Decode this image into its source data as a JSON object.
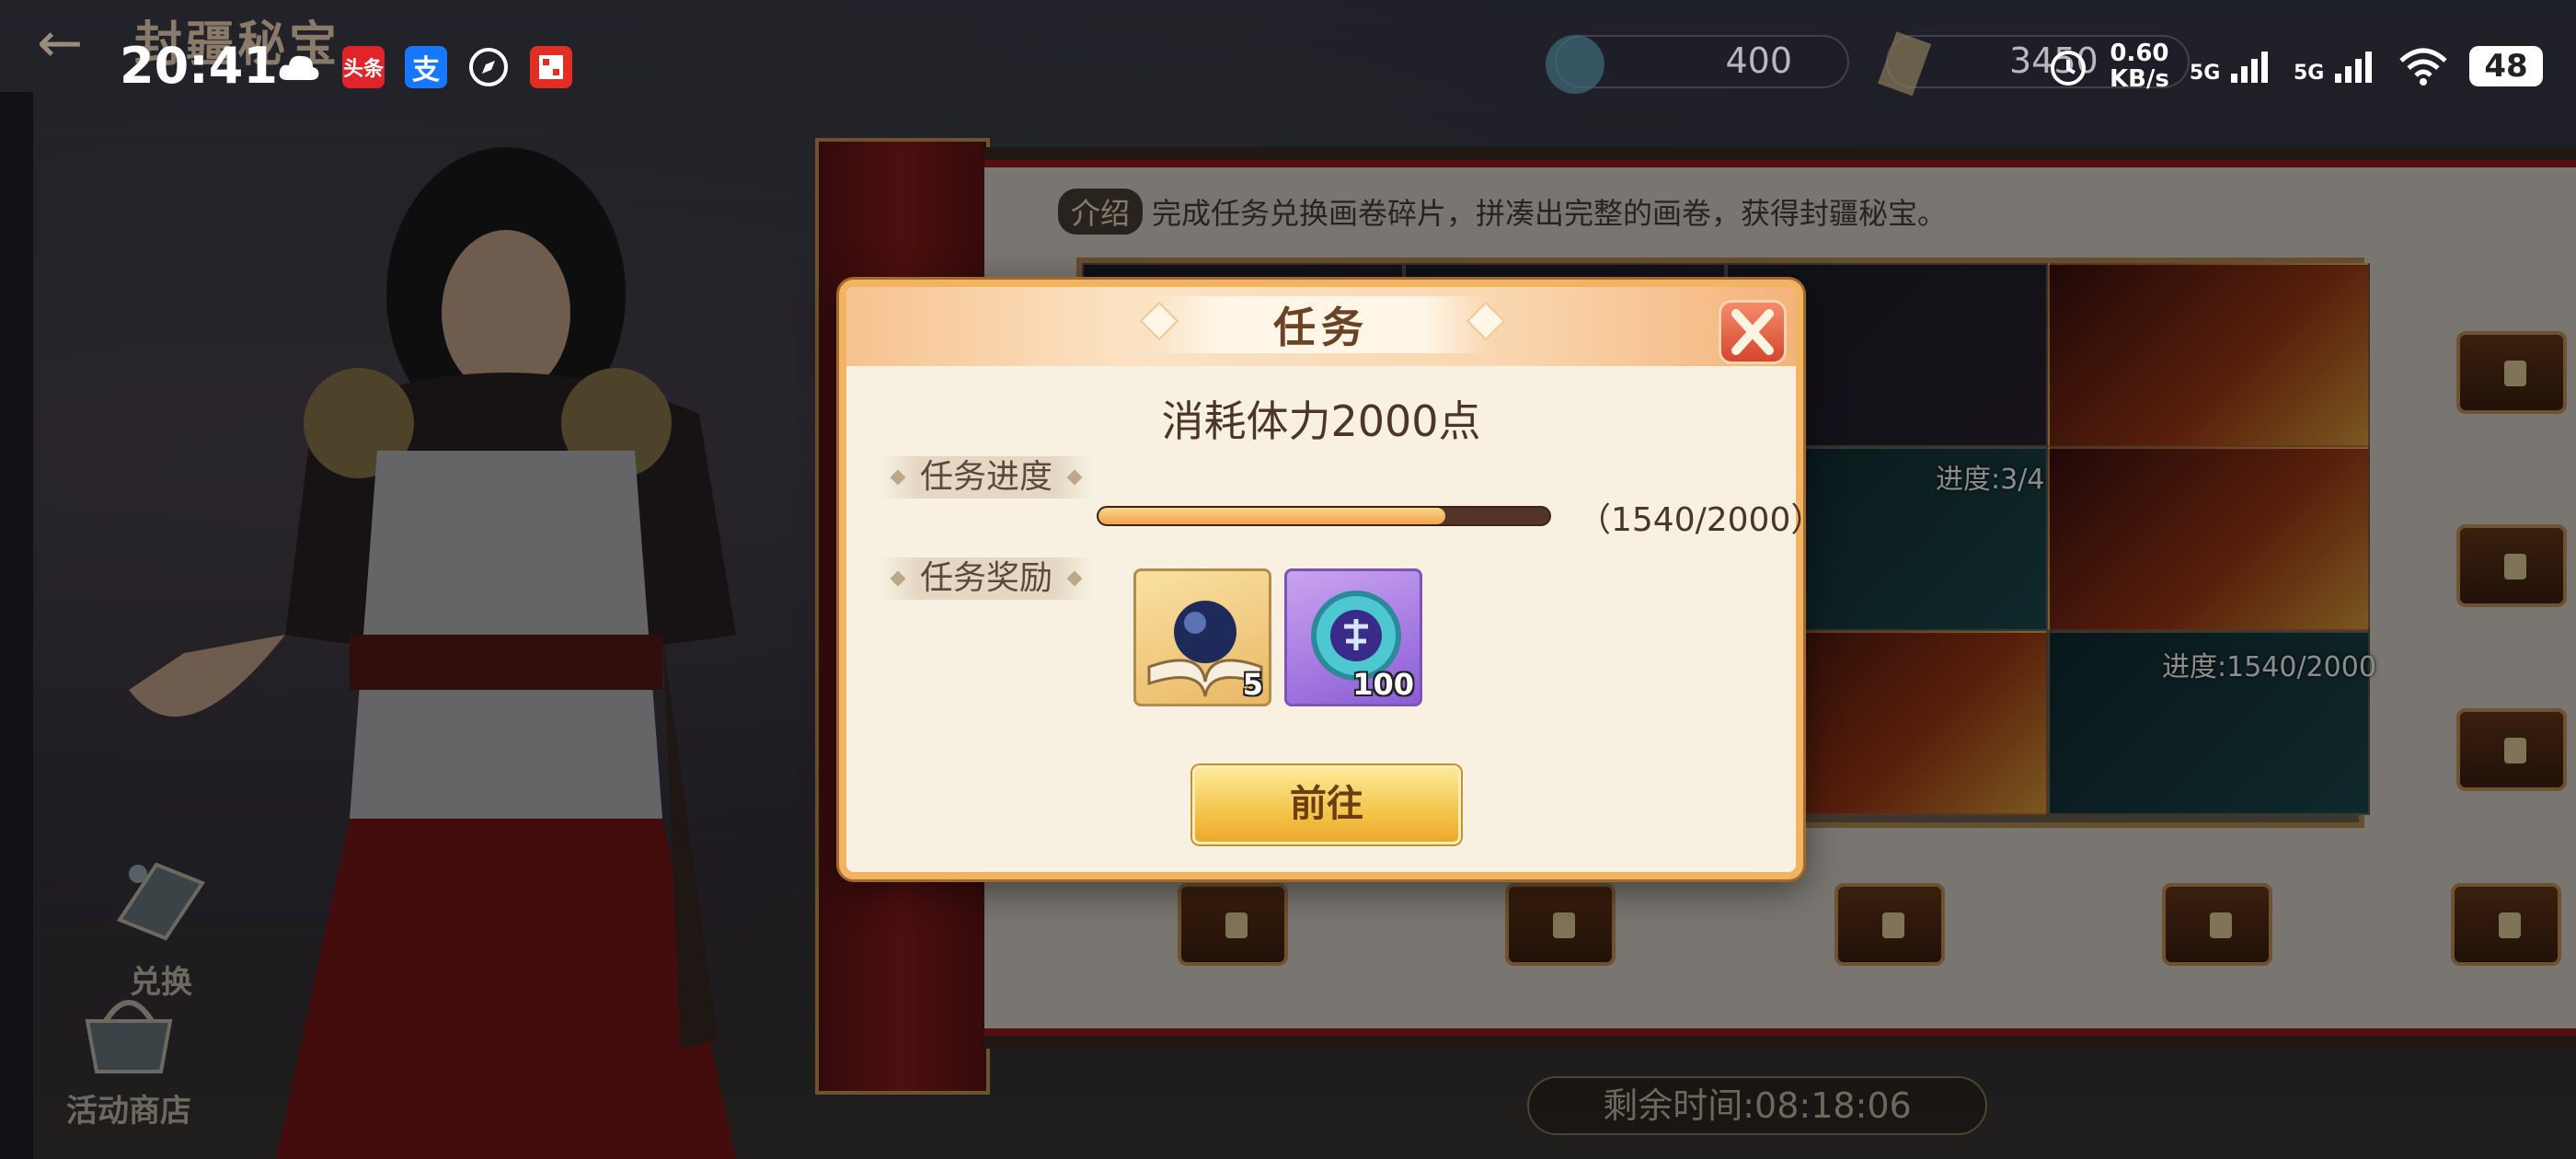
{
  "status_bar": {
    "time": "20:41",
    "apps": [
      {
        "icon": "cloud-icon",
        "label": ""
      },
      {
        "icon": "toutiao-icon",
        "label": "头条"
      },
      {
        "icon": "alipay-icon",
        "label": "支"
      },
      {
        "icon": "compass-icon",
        "label": ""
      },
      {
        "icon": "pinduoduo-icon",
        "label": ""
      }
    ],
    "net_speed_value": "0.60",
    "net_speed_unit": "KB/s",
    "signal_1": "5G",
    "signal_2": "5G",
    "battery": "48"
  },
  "game": {
    "title": "封疆秘宝",
    "currency_1": "400",
    "currency_2": "3450",
    "intro_tag": "介绍",
    "intro_text": "完成任务兑换画卷碎片，拼凑出完整的画卷，获得封疆秘宝。",
    "progress_labels": [
      "进度:3/4",
      "进度:1540/2000"
    ],
    "remaining_time": "剩余时间:08:18:06",
    "side_buttons": [
      {
        "label": "兑换",
        "icon": "exchange-icon"
      },
      {
        "label": "活动商店",
        "icon": "shop-icon"
      }
    ]
  },
  "modal": {
    "title": "任务",
    "task_description": "消耗体力2000点",
    "progress_label": "任务进度",
    "progress_text": "（1540/2000）",
    "progress_fraction": 0.77,
    "reward_label": "任务奖励",
    "rewards": [
      {
        "icon": "skill-book-icon",
        "count": "5"
      },
      {
        "icon": "jade-token-icon",
        "count": "100"
      }
    ],
    "go_button": "前往"
  },
  "colors": {
    "modal_border": "#f2b462",
    "modal_bg": "#f8f1e2",
    "progress_fill": "#f3a24a",
    "progress_track": "#533528",
    "go_button": "#f4c44a"
  }
}
